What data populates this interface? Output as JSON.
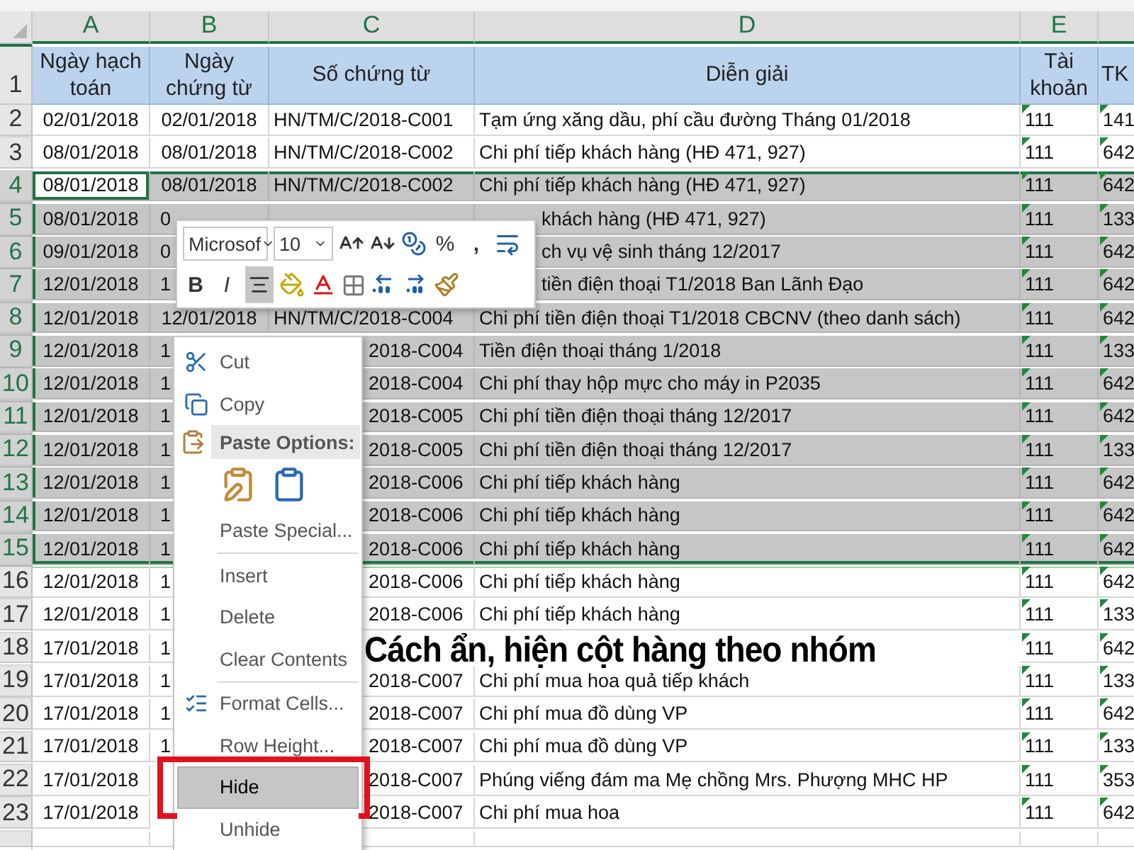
{
  "column_headers": [
    "A",
    "B",
    "C",
    "D",
    "E"
  ],
  "header_row": {
    "number": "1",
    "cells": [
      "Ngày hạch toán",
      "Ngày chứng từ",
      "Số chứng từ",
      "Diễn giải",
      "Tài khoản",
      "TK"
    ]
  },
  "rows": [
    {
      "number": "2",
      "selected": false,
      "active": false,
      "cells": [
        "02/01/2018",
        "02/01/2018",
        "HN/TM/C/2018-C001",
        "Tạm ứng xăng dầu, phí cầu đường Tháng 01/2018",
        "111",
        "141"
      ]
    },
    {
      "number": "3",
      "selected": false,
      "active": false,
      "cells": [
        "08/01/2018",
        "08/01/2018",
        "HN/TM/C/2018-C002",
        "Chi phí tiếp khách hàng (HĐ 471, 927)",
        "111",
        "642"
      ]
    },
    {
      "number": "4",
      "selected": true,
      "active": true,
      "cells": [
        "08/01/2018",
        "08/01/2018",
        "HN/TM/C/2018-C002",
        "Chi phí tiếp khách hàng (HĐ 471, 927)",
        "111",
        "642"
      ]
    },
    {
      "number": "5",
      "selected": true,
      "active": false,
      "cells": [
        "08/01/2018",
        {
          "kind": "head",
          "text": "0"
        },
        {
          "kind": "covered"
        },
        {
          "kind": "tail",
          "text": "khách hàng (HĐ 471, 927)"
        },
        "111",
        "133"
      ]
    },
    {
      "number": "6",
      "selected": true,
      "active": false,
      "cells": [
        "09/01/2018",
        {
          "kind": "head",
          "text": "0"
        },
        {
          "kind": "hidden"
        },
        {
          "kind": "tail",
          "text": "ch vụ vệ sinh tháng 12/2017"
        },
        "111",
        "642"
      ]
    },
    {
      "number": "7",
      "selected": true,
      "active": false,
      "cells": [
        "12/01/2018",
        {
          "kind": "head",
          "text": "1"
        },
        {
          "kind": "hidden"
        },
        {
          "kind": "tail",
          "text": "tiền điện thoại T1/2018 Ban Lãnh Đạo"
        },
        "111",
        "642"
      ]
    },
    {
      "number": "8",
      "selected": true,
      "active": false,
      "cells": [
        "12/01/2018",
        "12/01/2018",
        "HN/TM/C/2018-C004",
        "Chi phí tiền điện thoại T1/2018 CBCNV (theo danh sách)",
        "111",
        "642"
      ]
    },
    {
      "number": "9",
      "selected": true,
      "active": false,
      "cells": [
        "12/01/2018",
        {
          "kind": "head",
          "text": "1"
        },
        {
          "kind": "tail",
          "text": "2018-C004"
        },
        "Tiền điện thoại tháng 1/2018",
        "111",
        "133"
      ]
    },
    {
      "number": "10",
      "selected": true,
      "active": false,
      "cells": [
        "12/01/2018",
        {
          "kind": "head",
          "text": "1"
        },
        {
          "kind": "tail",
          "text": "2018-C004"
        },
        "Chi phí thay hộp mực cho máy in P2035",
        "111",
        "642"
      ]
    },
    {
      "number": "11",
      "selected": true,
      "active": false,
      "cells": [
        "12/01/2018",
        {
          "kind": "head",
          "text": "1"
        },
        {
          "kind": "tail",
          "text": "2018-C005"
        },
        "Chi phí tiền điện thoại tháng 12/2017",
        "111",
        "642"
      ]
    },
    {
      "number": "12",
      "selected": true,
      "active": false,
      "cells": [
        "12/01/2018",
        {
          "kind": "head",
          "text": "1"
        },
        {
          "kind": "tail",
          "text": "2018-C005"
        },
        "Chi phí tiền điện thoại tháng 12/2017",
        "111",
        "133"
      ]
    },
    {
      "number": "13",
      "selected": true,
      "active": false,
      "cells": [
        "12/01/2018",
        {
          "kind": "head",
          "text": "1"
        },
        {
          "kind": "tail",
          "text": "2018-C006"
        },
        "Chi phí tiếp khách hàng",
        "111",
        "642"
      ]
    },
    {
      "number": "14",
      "selected": true,
      "active": false,
      "cells": [
        "12/01/2018",
        {
          "kind": "head",
          "text": "1"
        },
        {
          "kind": "tail",
          "text": "2018-C006"
        },
        "Chi phí tiếp khách hàng",
        "111",
        "642"
      ]
    },
    {
      "number": "15",
      "selected": true,
      "active": false,
      "cells": [
        "12/01/2018",
        {
          "kind": "head",
          "text": "1"
        },
        {
          "kind": "tail",
          "text": "2018-C006"
        },
        "Chi phí tiếp khách hàng",
        "111",
        "642"
      ]
    },
    {
      "number": "16",
      "selected": false,
      "active": false,
      "cells": [
        "12/01/2018",
        {
          "kind": "head",
          "text": "1"
        },
        {
          "kind": "tail",
          "text": "2018-C006"
        },
        "Chi phí tiếp khách hàng",
        "111",
        "642"
      ]
    },
    {
      "number": "17",
      "selected": false,
      "active": false,
      "cells": [
        "12/01/2018",
        {
          "kind": "head",
          "text": "1"
        },
        {
          "kind": "tail",
          "text": "2018-C006"
        },
        "Chi phí tiếp khách hàng",
        "111",
        "133"
      ]
    },
    {
      "number": "18",
      "selected": false,
      "active": false,
      "cells": [
        "17/01/2018",
        {
          "kind": "head",
          "text": "1"
        },
        {
          "kind": "covered"
        },
        {
          "kind": "covered"
        },
        "111",
        "642"
      ]
    },
    {
      "number": "19",
      "selected": false,
      "active": false,
      "cells": [
        "17/01/2018",
        {
          "kind": "head",
          "text": "1"
        },
        {
          "kind": "tail",
          "text": "2018-C007"
        },
        "Chi phí mua hoa quả tiếp khách",
        "111",
        "133"
      ]
    },
    {
      "number": "20",
      "selected": false,
      "active": false,
      "cells": [
        "17/01/2018",
        {
          "kind": "head",
          "text": "1"
        },
        {
          "kind": "tail",
          "text": "2018-C007"
        },
        "Chi phí mua đồ dùng VP",
        "111",
        "642"
      ]
    },
    {
      "number": "21",
      "selected": false,
      "active": false,
      "cells": [
        "17/01/2018",
        {
          "kind": "head",
          "text": "1"
        },
        {
          "kind": "tail",
          "text": "2018-C007"
        },
        "Chi phí mua đồ dùng VP",
        "111",
        "133"
      ]
    },
    {
      "number": "22",
      "selected": false,
      "active": false,
      "cells": [
        "17/01/2018",
        {
          "kind": "covered"
        },
        {
          "kind": "tail",
          "text": "2018-C007"
        },
        "Phúng viếng đám ma Mẹ chồng Mrs. Phượng MHC HP",
        "111",
        "353"
      ]
    },
    {
      "number": "23",
      "selected": false,
      "active": false,
      "cells": [
        "17/01/2018",
        {
          "kind": "covered"
        },
        {
          "kind": "tail",
          "text": "2018-C007"
        },
        "Chi phí mua hoa",
        "111",
        "642"
      ]
    }
  ],
  "mini_toolbar": {
    "font": "Microsof",
    "size": "10",
    "percent": "%",
    "comma": ",",
    "bold": "B",
    "italic": "I",
    "center_selected": true
  },
  "context_menu": [
    {
      "kind": "item",
      "label": "Cut",
      "selected": false,
      "framed": false
    },
    {
      "kind": "item",
      "label": "Copy",
      "selected": false,
      "framed": false
    },
    {
      "kind": "header",
      "label": "Paste Options:"
    },
    {
      "kind": "paste_icons"
    },
    {
      "kind": "item",
      "label": "Paste Special...",
      "selected": false,
      "framed": false
    },
    {
      "kind": "separator"
    },
    {
      "kind": "item",
      "label": "Insert",
      "selected": false,
      "framed": false
    },
    {
      "kind": "item",
      "label": "Delete",
      "selected": false,
      "framed": false
    },
    {
      "kind": "item",
      "label": "Clear Contents",
      "selected": false,
      "framed": false
    },
    {
      "kind": "separator"
    },
    {
      "kind": "item",
      "label": "Format Cells...",
      "selected": false,
      "framed": false
    },
    {
      "kind": "item",
      "label": "Row Height...",
      "selected": false,
      "framed": false
    },
    {
      "kind": "item",
      "label": "Hide",
      "selected": true,
      "framed": true
    },
    {
      "kind": "item",
      "label": "Unhide",
      "selected": false,
      "framed": false
    }
  ],
  "caption": "Cách ẩn, hiện cột hàng theo nhóm"
}
